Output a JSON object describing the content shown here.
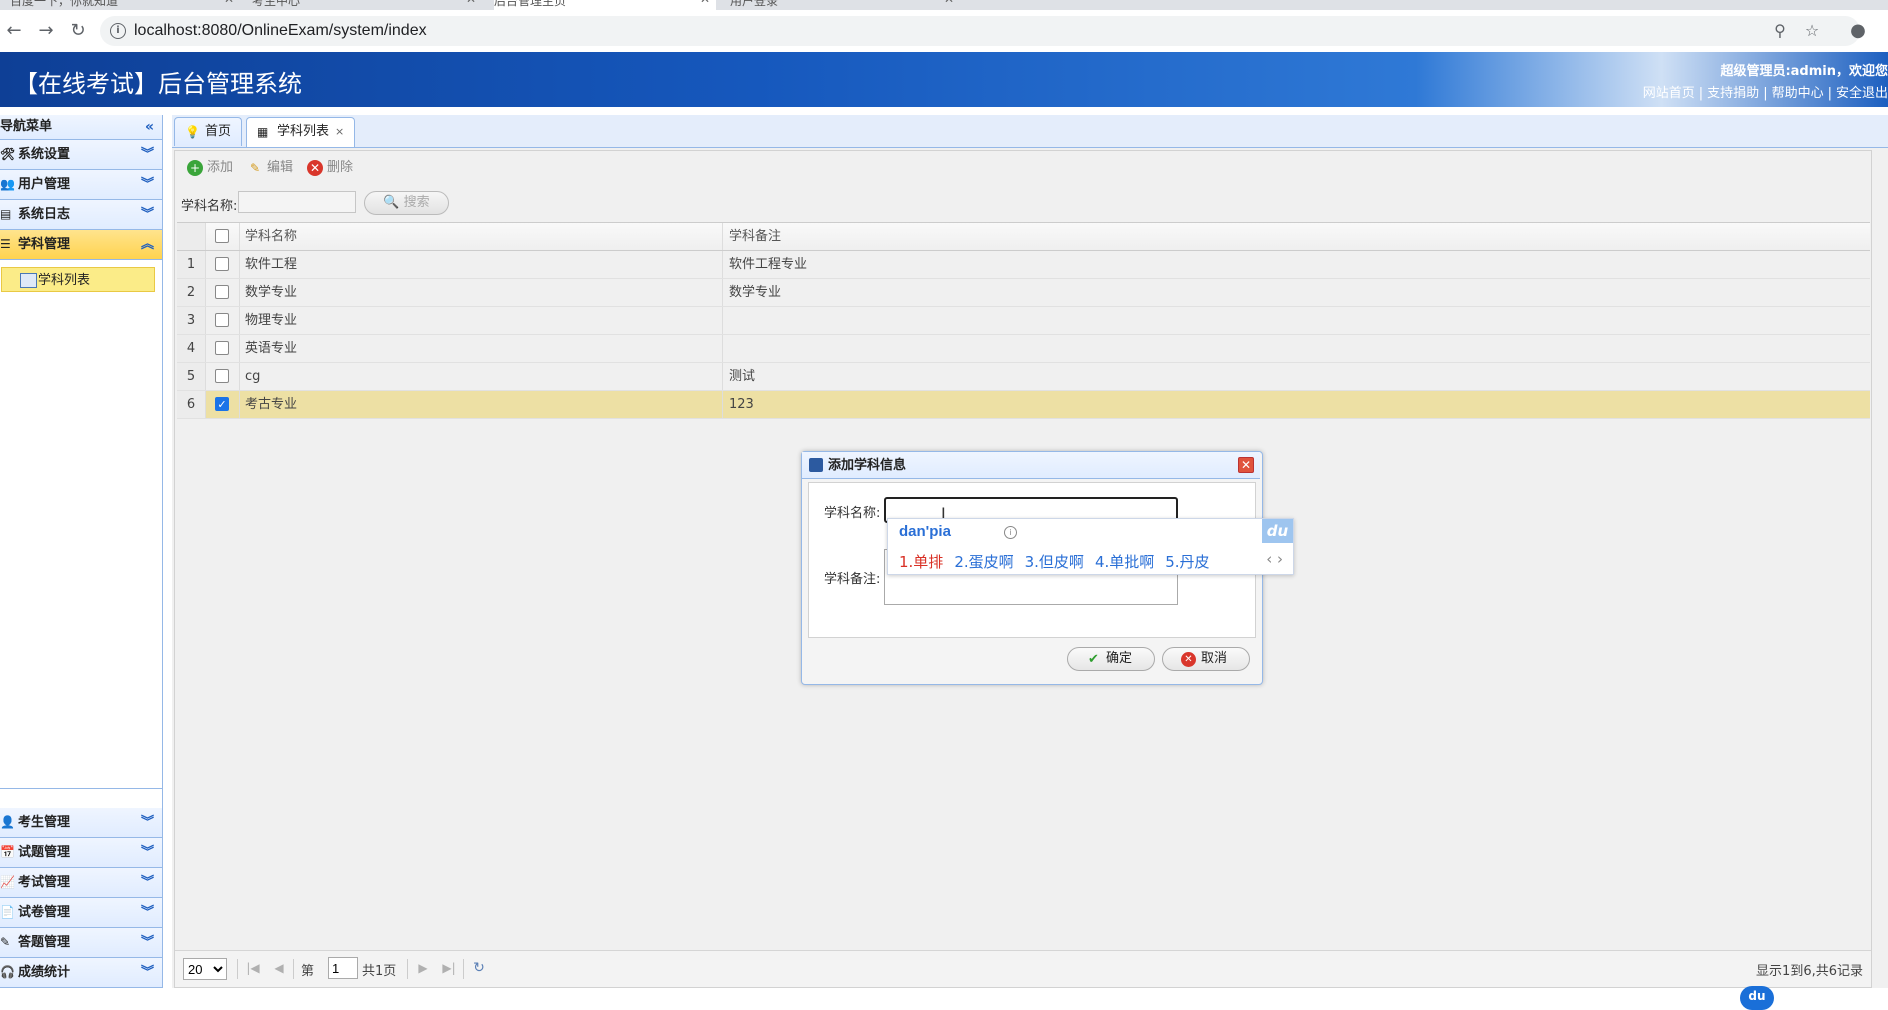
{
  "browser": {
    "tabs": [
      {
        "title": "百度一下，你就知道"
      },
      {
        "title": "考生中心"
      },
      {
        "title": "后台管理主页"
      },
      {
        "title": "用户登录"
      }
    ],
    "url": "localhost:8080/OnlineExam/system/index"
  },
  "header": {
    "title": "【在线考试】后台管理系统",
    "welcome": "超级管理员:admin，欢迎您",
    "links": [
      "网站首页",
      "支持捐助",
      "帮助中心",
      "安全退出"
    ]
  },
  "sidebar": {
    "title": "导航菜单",
    "menus_top": [
      {
        "label": "系统设置",
        "icon": "tools-icon"
      },
      {
        "label": "用户管理",
        "icon": "users-icon"
      },
      {
        "label": "系统日志",
        "icon": "log-icon"
      },
      {
        "label": "学科管理",
        "icon": "list-icon",
        "selected": true
      }
    ],
    "active_item": "学科列表",
    "menus_bottom": [
      {
        "label": "考生管理",
        "icon": "students-icon"
      },
      {
        "label": "试题管理",
        "icon": "calendar-icon"
      },
      {
        "label": "考试管理",
        "icon": "exam-icon"
      },
      {
        "label": "试卷管理",
        "icon": "paper-icon"
      },
      {
        "label": "答题管理",
        "icon": "answer-icon"
      },
      {
        "label": "成绩统计",
        "icon": "stats-icon"
      }
    ]
  },
  "panel_tabs": [
    {
      "label": "首页",
      "icon": "bulb-icon"
    },
    {
      "label": "学科列表",
      "icon": "table-icon",
      "active": true,
      "close": "×"
    }
  ],
  "toolbar": {
    "add": "添加",
    "edit": "编辑",
    "delete": "删除"
  },
  "search": {
    "label": "学科名称:",
    "value": "",
    "button": "搜索"
  },
  "grid": {
    "headers": {
      "name": "学科名称",
      "remark": "学科备注"
    },
    "rows": [
      {
        "num": "1",
        "name": "软件工程",
        "remark": "软件工程专业",
        "checked": false
      },
      {
        "num": "2",
        "name": "数学专业",
        "remark": "数学专业",
        "checked": false
      },
      {
        "num": "3",
        "name": "物理专业",
        "remark": "",
        "checked": false
      },
      {
        "num": "4",
        "name": "英语专业",
        "remark": "",
        "checked": false
      },
      {
        "num": "5",
        "name": "cg",
        "remark": "测试",
        "checked": false
      },
      {
        "num": "6",
        "name": "考古专业",
        "remark": "123",
        "checked": true
      }
    ]
  },
  "pager": {
    "page_size": "20",
    "page_prefix": "第",
    "page_value": "1",
    "page_suffix": "共1页",
    "info": "显示1到6,共6记录"
  },
  "dialog": {
    "title": "添加学科信息",
    "name_label": "学科名称:",
    "remark_label": "学科备注:",
    "ok": "确定",
    "cancel": "取消"
  },
  "ime": {
    "pinyin": "dan'pia",
    "candidates": [
      "1.单排",
      "2.蛋皮啊",
      "3.但皮啊",
      "4.单批啊",
      "5.丹皮"
    ],
    "logo": "du"
  }
}
